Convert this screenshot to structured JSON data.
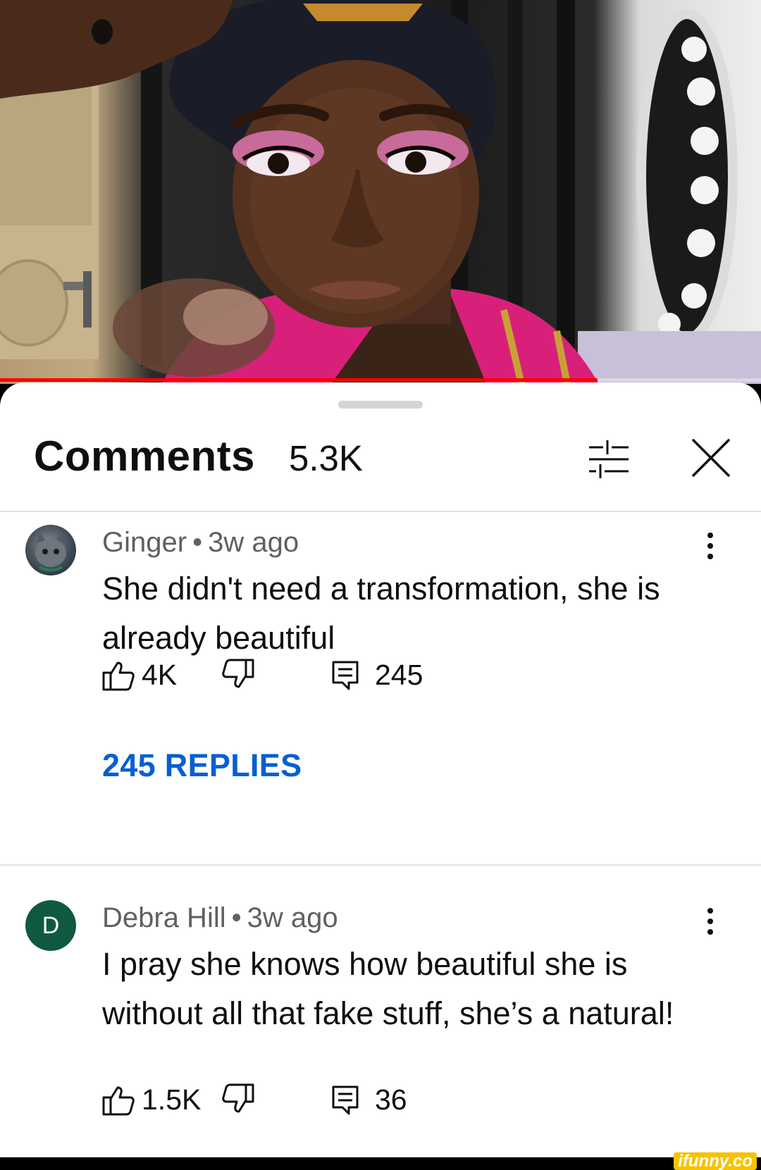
{
  "video": {
    "progress": 0.785,
    "progress_color": "#ff0000"
  },
  "comments_panel": {
    "title": "Comments",
    "count": "5.3K",
    "filter_icon": "filter-sliders-icon",
    "close_icon": "close-icon"
  },
  "comments": [
    {
      "author": "Ginger",
      "separator": "•",
      "time": "3w ago",
      "text": "She didn't need a transformation, she is already beautiful",
      "likes": "4K",
      "reply_count": "245",
      "replies_label": "245 REPLIES",
      "avatar": "cat-photo-avatar"
    },
    {
      "author": "Debra Hill",
      "separator": "•",
      "time": "3w ago",
      "text": "I pray she knows how beautiful she is without all that fake stuff, she’s a natural!",
      "likes": "1.5K",
      "reply_count": "36",
      "avatar_letter": "D",
      "avatar_color": "#0f5a3e"
    }
  ],
  "colors": {
    "link": "#065fd4",
    "secondary_text": "#606060"
  },
  "watermark": "ifunny.co"
}
